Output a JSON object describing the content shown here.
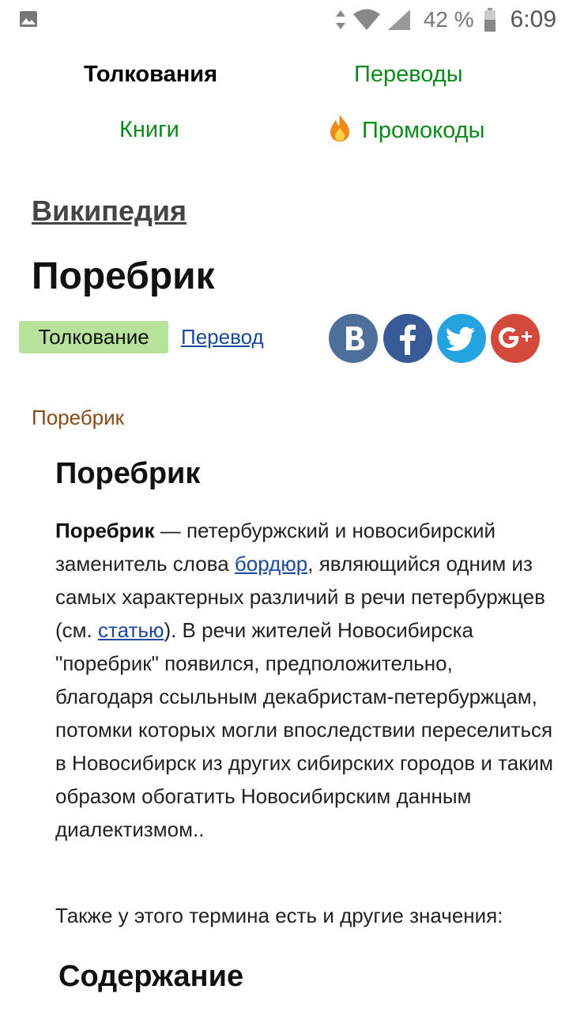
{
  "status_bar": {
    "battery_text": "42 %",
    "time": "6:09",
    "icons": [
      "image-notification-icon",
      "data-arrows-icon",
      "wifi-icon",
      "cell-signal-icon",
      "battery-icon"
    ]
  },
  "nav": {
    "interpretations": "Толкования",
    "translations": "Переводы",
    "books": "Книги",
    "promocodes": "Промокоды",
    "promo_icon": "fire-icon"
  },
  "source_link": "Википедия",
  "page_title": "Поребрик",
  "tabs": {
    "interpretation": "Толкование",
    "translation": "Перевод"
  },
  "share_icons": [
    "vk-icon",
    "facebook-icon",
    "twitter-icon",
    "google-plus-icon"
  ],
  "section_label": "Поребрик",
  "article": {
    "title": "Поребрик",
    "term": "Поребрик",
    "p1": " — петербуржский и новосибирский заменитель слова ",
    "link1": "бордюр",
    "p2": ", являющийся одним из самых характерных различий в речи петербуржцев (см. ",
    "link2": "статью",
    "p3": "). В речи жителей Новосибирска \"поребрик\" появился, предположительно, благодаря ссыльным декабристам-петербуржцам, потомки которых могли впоследствии переселиться в Новосибирск из других сибирских городов и таким образом обогатить Новосибирским данным диалектизмом..",
    "also": "Также у этого термина есть и другие значения:",
    "contents_title": "Содержание"
  },
  "colors": {
    "nav_link": "#0a8a1a",
    "tab_active_bg": "#b7e39a",
    "link": "#1a4aa0",
    "section_label": "#8a4a1a",
    "vk": "#4e6f99",
    "facebook": "#385a97",
    "twitter": "#25a3e0",
    "google_plus": "#d14a3c"
  }
}
